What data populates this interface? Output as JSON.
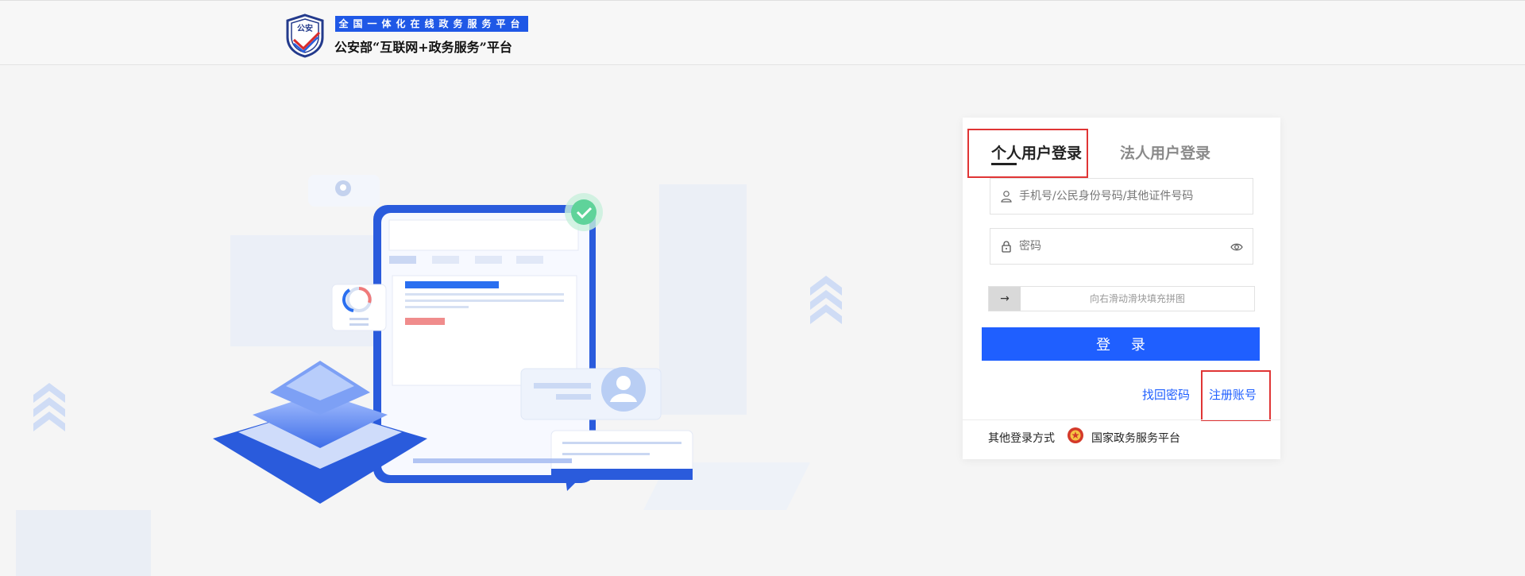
{
  "header": {
    "shield_text": "公安",
    "tagline": "全国一体化在线政务服务平台",
    "title": "公安部“互联网+政务服务”平台"
  },
  "login": {
    "tabs": [
      {
        "label": "个人用户登录",
        "active": true
      },
      {
        "label": "法人用户登录",
        "active": false
      }
    ],
    "username": {
      "placeholder": "手机号/公民身份号码/其他证件号码",
      "value": ""
    },
    "password": {
      "placeholder": "密码",
      "value": ""
    },
    "slider": {
      "handle": "→",
      "text": "向右滑动滑块填充拼图"
    },
    "submit_label": "登 录",
    "forgot_label": "找回密码",
    "register_label": "注册账号",
    "other_methods_label": "其他登录方式",
    "gov_platform_label": "国家政务服务平台"
  },
  "colors": {
    "accent": "#1f5fff",
    "tagline_bg": "#1f58e6",
    "highlight": "#e03535",
    "page_bg": "#f5f5f5"
  }
}
